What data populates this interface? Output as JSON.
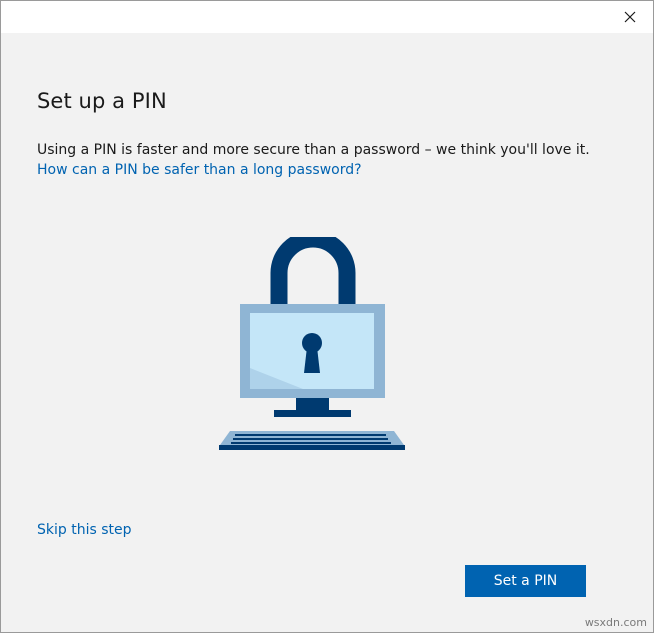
{
  "dialog": {
    "title": "Set up a PIN",
    "description": "Using a PIN is faster and more secure than a password – we think you'll love it.",
    "help_link": "How can a PIN be safer than a long password?",
    "skip_link": "Skip this step",
    "primary_button": "Set a PIN"
  },
  "titlebar": {
    "close_icon": "close-icon"
  },
  "illustration": {
    "icon": "padlock-computer-icon",
    "colors": {
      "dark": "#003a70",
      "frame": "#8fb5d4",
      "screen": "#c4e6f8",
      "accent": "#0063b1"
    }
  },
  "watermark": "wsxdn.com"
}
